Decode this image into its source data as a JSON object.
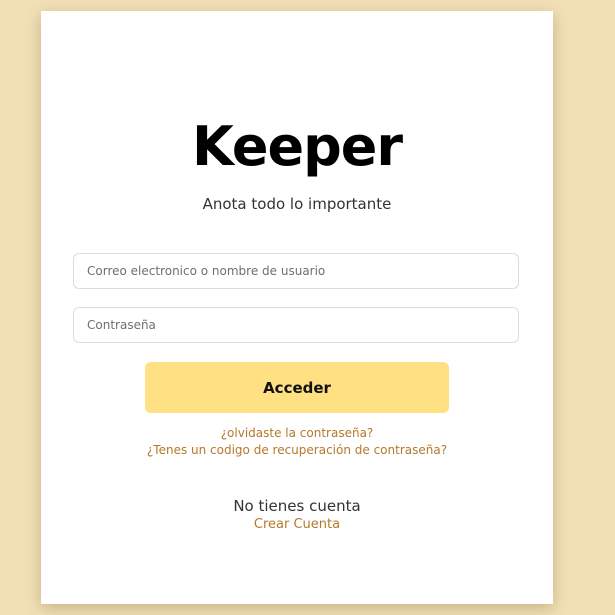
{
  "app": {
    "title": "Keeper",
    "tagline": "Anota todo lo importante"
  },
  "form": {
    "username_placeholder": "Correo electronico o nombre de usuario",
    "username_value": "",
    "password_placeholder": "Contraseña",
    "password_value": "",
    "submit_label": "Acceder"
  },
  "links": {
    "forgot_password": "¿olvidaste la contraseña?",
    "recovery_code": "¿Tenes un codigo de recuperación de contraseña?"
  },
  "signup": {
    "prompt": "No tienes cuenta",
    "create_label": "Crear Cuenta"
  },
  "colors": {
    "page_background": "#f1e0b6",
    "card_background": "#ffffff",
    "button_background": "#ffe082",
    "link_color": "#b5782a"
  }
}
